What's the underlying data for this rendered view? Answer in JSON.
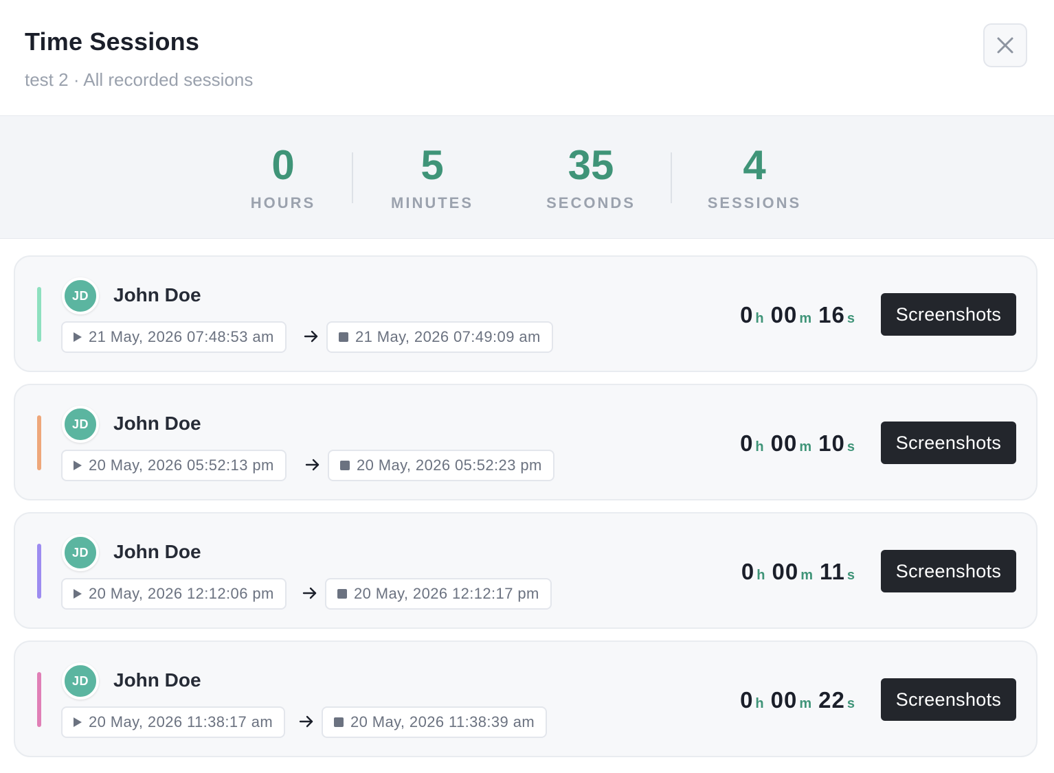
{
  "header": {
    "title": "Time Sessions",
    "subtitle": "test 2 · All recorded sessions"
  },
  "summary": {
    "hours": {
      "value": "0",
      "label": "HOURS"
    },
    "minutes": {
      "value": "5",
      "label": "MINUTES"
    },
    "seconds": {
      "value": "35",
      "label": "SECONDS"
    },
    "sessions": {
      "value": "4",
      "label": "SESSIONS"
    }
  },
  "sessions": [
    {
      "accent_color": "#8ee0bf",
      "avatar_initials": "JD",
      "user_name": "John Doe",
      "start": "21 May, 2026 07:48:53 am",
      "end": "21 May, 2026 07:49:09 am",
      "duration": {
        "h": "0",
        "h_unit": "h",
        "m": "00",
        "m_unit": "m",
        "s": "16",
        "s_unit": "s"
      },
      "button_label": "Screenshots"
    },
    {
      "accent_color": "#eea77a",
      "avatar_initials": "JD",
      "user_name": "John Doe",
      "start": "20 May, 2026 05:52:13 pm",
      "end": "20 May, 2026 05:52:23 pm",
      "duration": {
        "h": "0",
        "h_unit": "h",
        "m": "00",
        "m_unit": "m",
        "s": "10",
        "s_unit": "s"
      },
      "button_label": "Screenshots"
    },
    {
      "accent_color": "#9d8cf0",
      "avatar_initials": "JD",
      "user_name": "John Doe",
      "start": "20 May, 2026 12:12:06 pm",
      "end": "20 May, 2026 12:12:17 pm",
      "duration": {
        "h": "0",
        "h_unit": "h",
        "m": "00",
        "m_unit": "m",
        "s": "11",
        "s_unit": "s"
      },
      "button_label": "Screenshots"
    },
    {
      "accent_color": "#e07fb6",
      "avatar_initials": "JD",
      "user_name": "John Doe",
      "start": "20 May, 2026 11:38:17 am",
      "end": "20 May, 2026 11:38:39 am",
      "duration": {
        "h": "0",
        "h_unit": "h",
        "m": "00",
        "m_unit": "m",
        "s": "22",
        "s_unit": "s"
      },
      "button_label": "Screenshots"
    }
  ],
  "icons": {
    "close": "close-icon",
    "start": "play-icon",
    "end": "stop-icon",
    "arrow": "arrow-right-icon"
  }
}
